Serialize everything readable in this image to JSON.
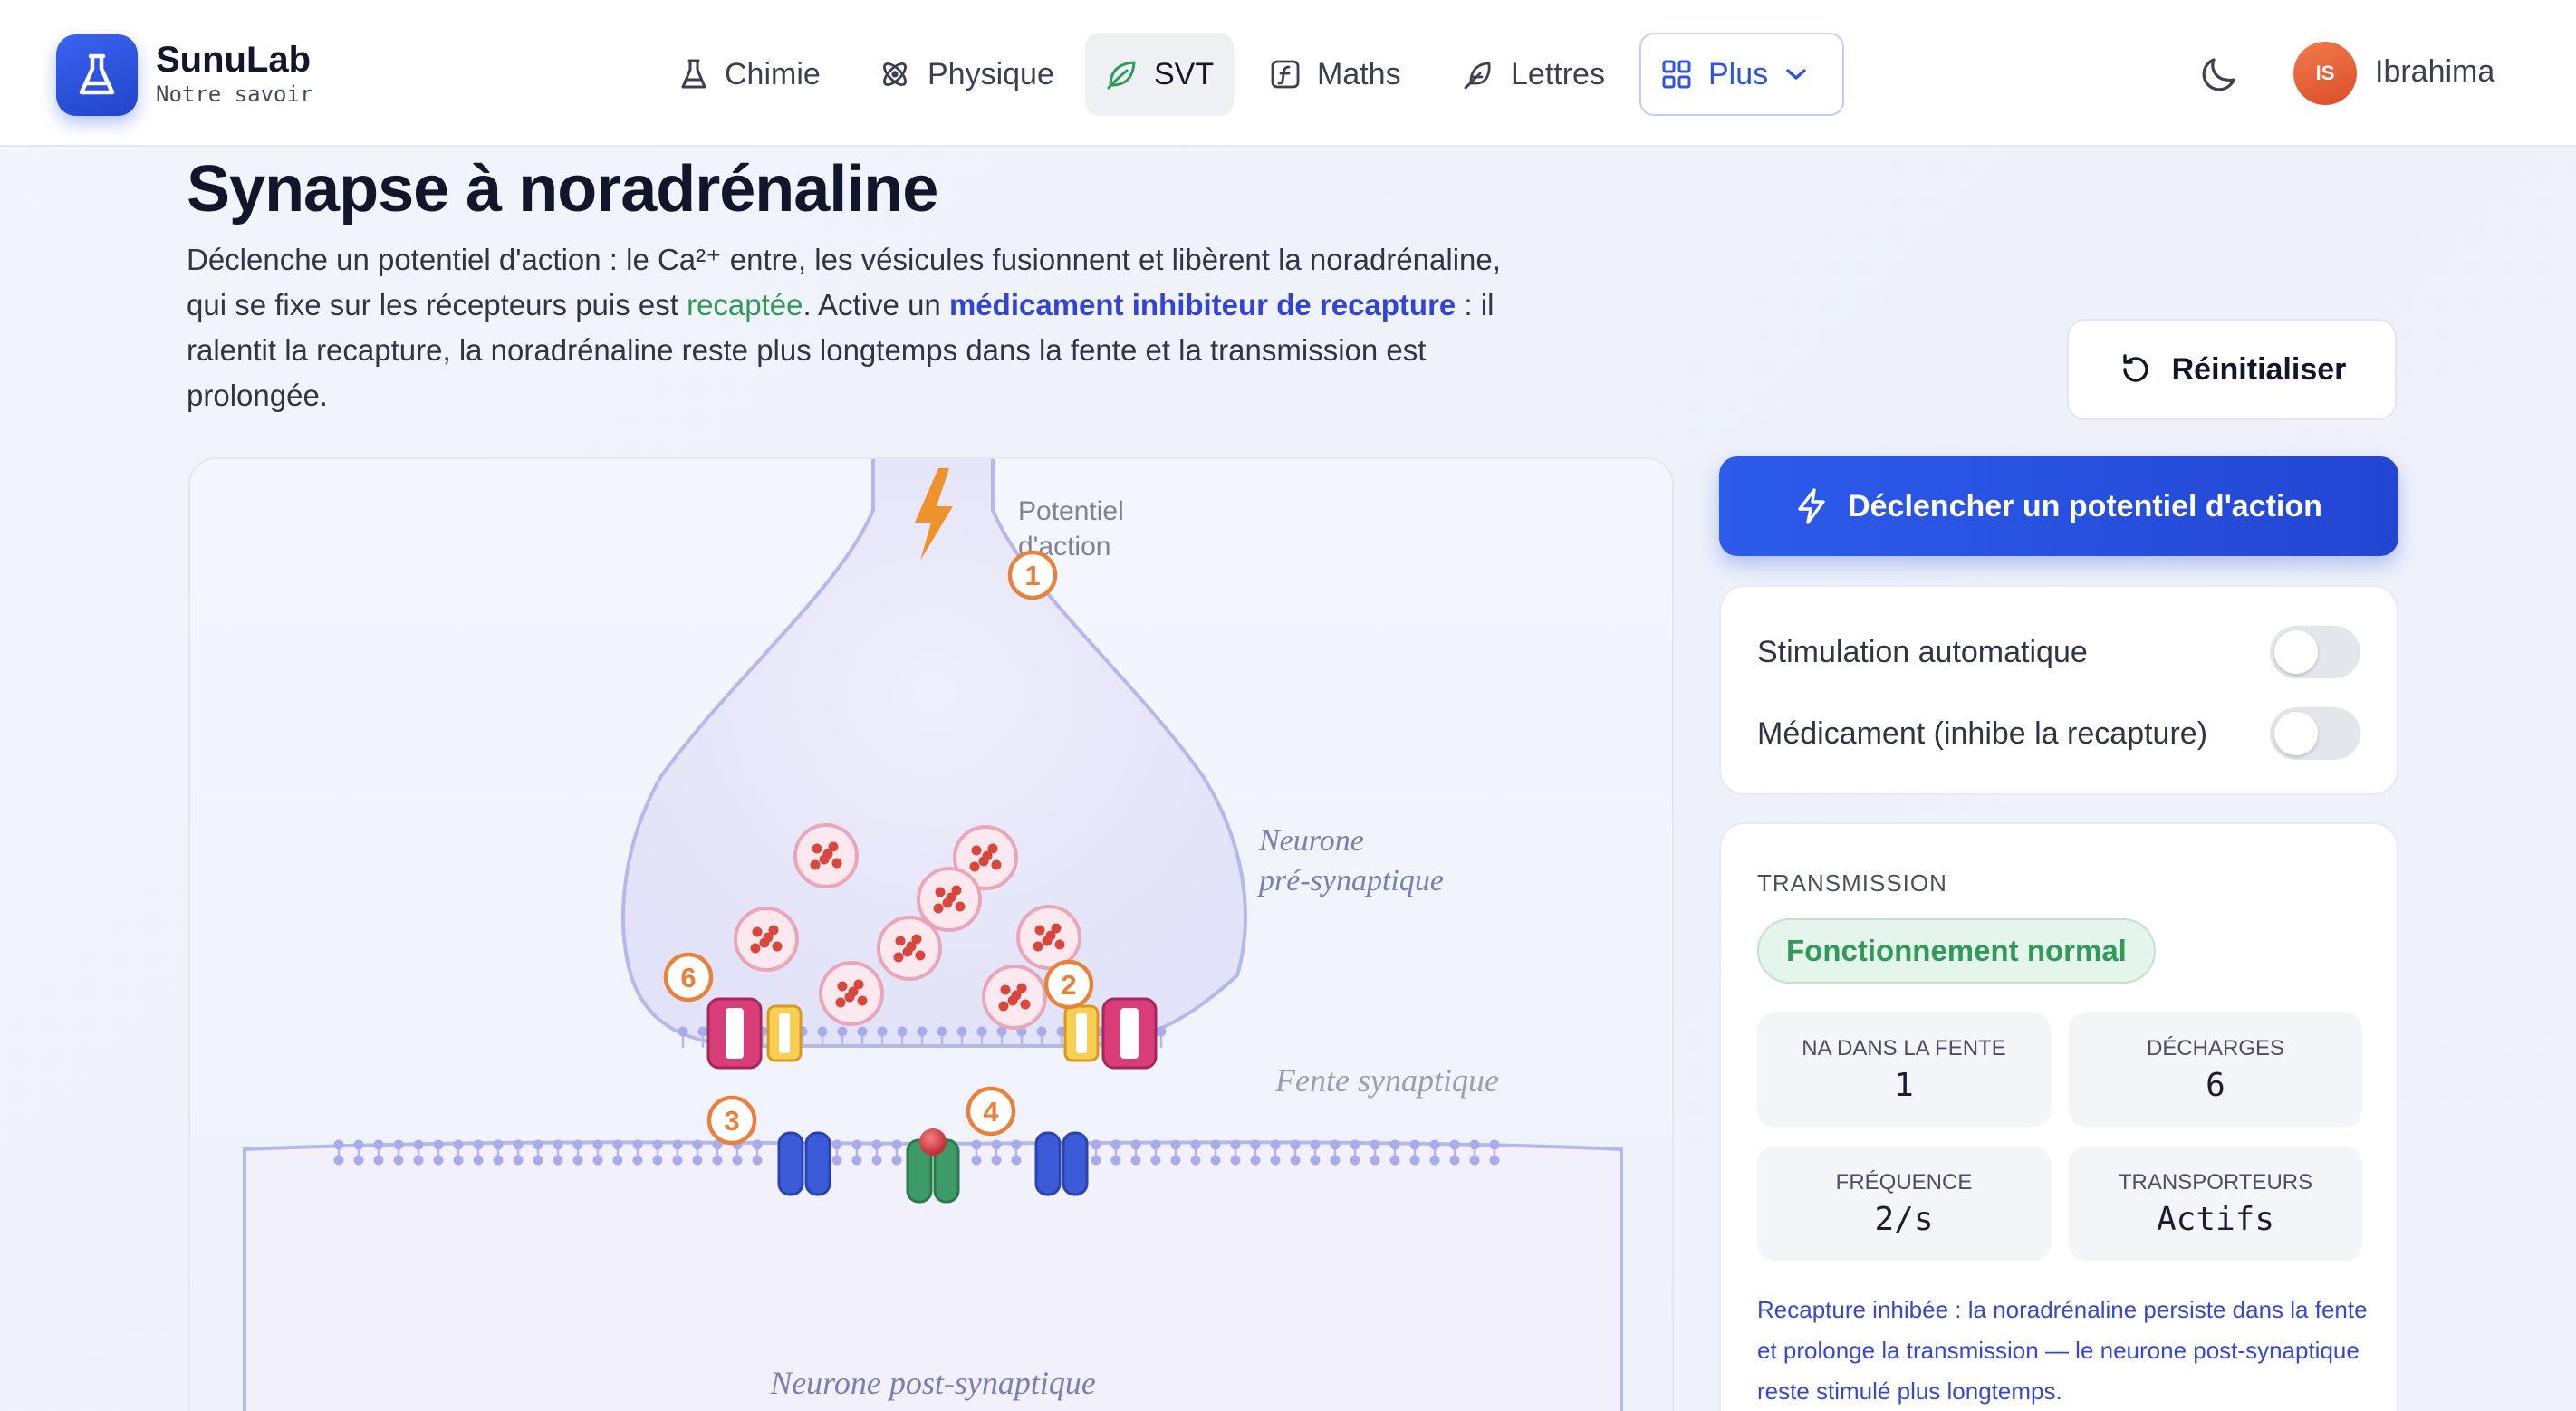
{
  "brand": {
    "name": "SunuLab",
    "tagline": "Notre savoir"
  },
  "nav": [
    {
      "label": "Chimie",
      "icon": "flask-icon"
    },
    {
      "label": "Physique",
      "icon": "atom-icon"
    },
    {
      "label": "SVT",
      "icon": "leaf-icon",
      "active": true
    },
    {
      "label": "Maths",
      "icon": "function-icon"
    },
    {
      "label": "Lettres",
      "icon": "feather-icon"
    },
    {
      "label": "Plus",
      "icon": "grid-icon",
      "dropdown": true
    }
  ],
  "user": {
    "initials": "IS",
    "name": "Ibrahima"
  },
  "page": {
    "title": "Synapse à noradrénaline",
    "intro_1": "Déclenche un potentiel d'action : le Ca²⁺ entre, les vésicules fusionnent et libèrent la noradrénaline, qui se fixe sur les récepteurs puis est ",
    "intro_recaptee": "recaptée",
    "intro_2": ". Active un ",
    "intro_drug": "médicament inhibiteur de recapture",
    "intro_3": " : il ralentit la recapture, la noradrénaline reste plus longtemps dans la fente et la transmission est prolongée."
  },
  "controls": {
    "reset_label": "Réinitialiser",
    "fire_label": "Déclencher un potentiel d'action",
    "toggle_auto": {
      "label": "Stimulation automatique",
      "on": false
    },
    "toggle_drug": {
      "label": "Médicament (inhibe la recapture)",
      "on": false
    }
  },
  "diagram": {
    "label_potential_1": "Potentiel",
    "label_potential_2": "d'action",
    "label_pre_1": "Neurone",
    "label_pre_2": "pré-synaptique",
    "label_cleft": "Fente synaptique",
    "label_post": "Neurone post-synaptique",
    "steps": [
      "1",
      "2",
      "3",
      "4",
      "6"
    ]
  },
  "transmission": {
    "heading": "TRANSMISSION",
    "status": "Fonctionnement normal",
    "stats": [
      {
        "label": "NA DANS LA FENTE",
        "value": "1"
      },
      {
        "label": "DÉCHARGES",
        "value": "6"
      },
      {
        "label": "FRÉQUENCE",
        "value": "2/s"
      },
      {
        "label": "TRANSPORTEURS",
        "value": "Actifs"
      }
    ],
    "note": "Recapture inhibée : la noradrénaline persiste dans la fente et prolonge la transmission — le neurone post-synaptique reste stimulé plus longtemps."
  },
  "colors": {
    "accent": "#2d55e0",
    "success": "#2f9a5a",
    "step_orange": "#e9813a",
    "membrane": "#b7b9ee",
    "vesicle": "#e0556a"
  }
}
